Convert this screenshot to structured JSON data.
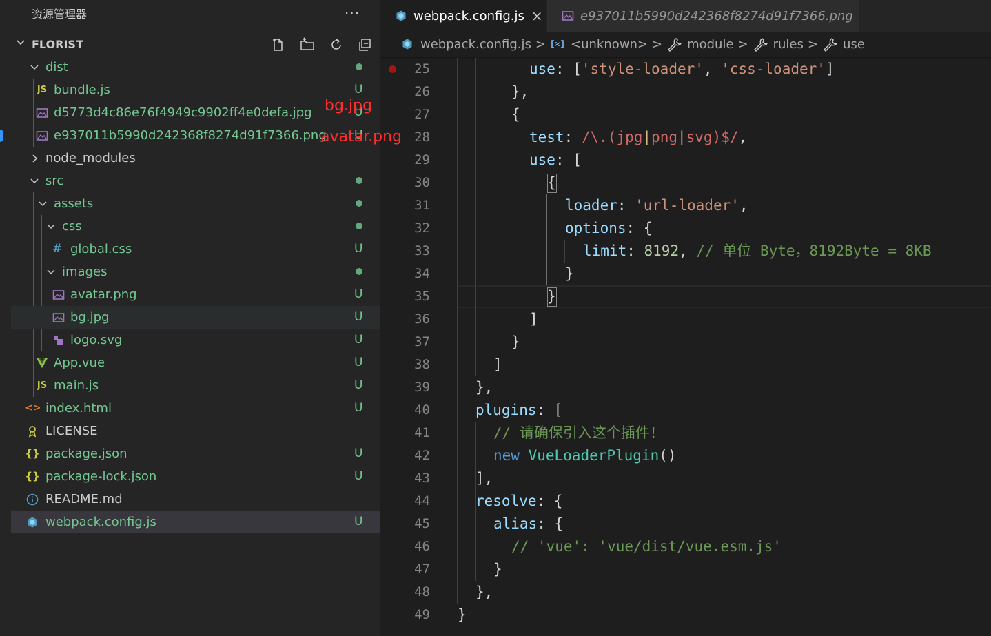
{
  "explorer": {
    "title": "资源管理器",
    "more": "···",
    "project": "FLORIST",
    "items": [
      {
        "label": "dist",
        "status": "dot"
      },
      {
        "label": "bundle.js",
        "status": "U"
      },
      {
        "label": "d5773d4c86e76f4949c9902ff4e0defa.jpg",
        "status": "U"
      },
      {
        "label": "e937011b5990d242368f8274d91f7366.png",
        "status": "U"
      },
      {
        "label": "node_modules",
        "status": ""
      },
      {
        "label": "src",
        "status": "dot"
      },
      {
        "label": "assets",
        "status": "dot"
      },
      {
        "label": "css",
        "status": "dot"
      },
      {
        "label": "global.css",
        "status": "U"
      },
      {
        "label": "images",
        "status": "dot"
      },
      {
        "label": "avatar.png",
        "status": "U"
      },
      {
        "label": "bg.jpg",
        "status": "U"
      },
      {
        "label": "logo.svg",
        "status": "U"
      },
      {
        "label": "App.vue",
        "status": "U"
      },
      {
        "label": "main.js",
        "status": "U"
      },
      {
        "label": "index.html",
        "status": "U"
      },
      {
        "label": "LICENSE",
        "status": ""
      },
      {
        "label": "package.json",
        "status": "U"
      },
      {
        "label": "package-lock.json",
        "status": "U"
      },
      {
        "label": "README.md",
        "status": ""
      },
      {
        "label": "webpack.config.js",
        "status": "U"
      }
    ],
    "annotations": {
      "bg": "bg.jpg",
      "avatar": "avatar.png"
    },
    "js_badge": "JS",
    "hash_badge": "#",
    "vue_badge": "V",
    "braces_badge": "{}",
    "info_badge": "i",
    "html_badge": "<>"
  },
  "tabs": [
    {
      "label": "webpack.config.js",
      "close": "×"
    },
    {
      "label": "e937011b5990d242368f8274d91f7366.png"
    }
  ],
  "breadcrumbs": [
    "webpack.config.js",
    "<unknown>",
    "module",
    "rules",
    "use"
  ],
  "breadcrumb_sep": ">",
  "editor": {
    "line_numbers": [
      "25",
      "26",
      "27",
      "28",
      "29",
      "30",
      "31",
      "32",
      "33",
      "34",
      "35",
      "36",
      "37",
      "38",
      "39",
      "40",
      "41",
      "42",
      "43",
      "44",
      "45",
      "46",
      "47",
      "48",
      "49"
    ],
    "tokens": {
      "use": "use",
      "colon": ": ",
      "style_loader": "'style-loader'",
      "comma_sp": ", ",
      "css_loader": "'css-loader'",
      "lbr": "[",
      "rbr": "]",
      "lbrace": "{",
      "rbrace": "}",
      "rbrace_comma": "},",
      "rbr_comma": "],",
      "test": "test",
      "regex_open": "/\\.(",
      "jpg": "jpg",
      "bar": "|",
      "png": "png",
      "svg": "svg",
      "regex_close": ")$/",
      "comma": ",",
      "loader": "loader",
      "url_loader": "'url-loader'",
      "options": "options",
      "colon_lbrace": ": {",
      "limit": "limit",
      "limit_val": "8192",
      "limit_comment": "// 单位 Byte，8192Byte = 8KB",
      "plugins": "plugins",
      "colon_lbr": ": [",
      "plugin_comment": "// 请确保引入这个插件！",
      "new_kw": "new",
      "plugin_class": "VueLoaderPlugin",
      "parens": "()",
      "resolve": "resolve",
      "alias": "alias",
      "alias_comment": "// 'vue': 'vue/dist/vue.esm.js'"
    }
  }
}
